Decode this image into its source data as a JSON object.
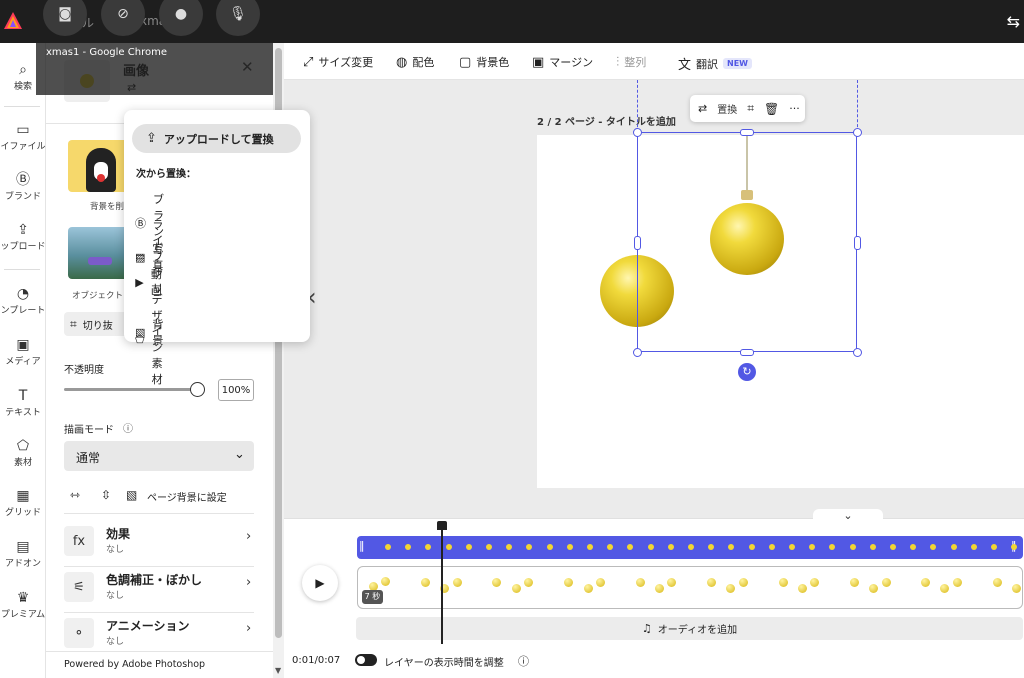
{
  "topbar": {
    "file_label": "ファイル",
    "doc_label": "xmas1",
    "chrome_label": "xmas1 - Google Chrome",
    "recorder": {
      "camera": "camera-icon",
      "no_cam": "camera-off-icon",
      "record": "record-icon",
      "mic": "microphone-icon"
    }
  },
  "leftnav": [
    {
      "icon": "search-icon",
      "glyph": "⌕",
      "label": "検索"
    },
    {
      "icon": "folder-icon",
      "glyph": "▭",
      "label": "イファイル"
    },
    {
      "icon": "brand-icon",
      "glyph": "Ⓑ",
      "label": "ブランド"
    },
    {
      "icon": "upload-icon",
      "glyph": "⇪",
      "label": "ップロード"
    },
    {
      "icon": "template-icon",
      "glyph": "◔",
      "label": "ンプレート"
    },
    {
      "icon": "media-icon",
      "glyph": "▣",
      "label": "メディア"
    },
    {
      "icon": "text-icon",
      "glyph": "T",
      "label": "テキスト"
    },
    {
      "icon": "elements-icon",
      "glyph": "⬠",
      "label": "素材"
    },
    {
      "icon": "grid-icon",
      "glyph": "▦",
      "label": "グリッド"
    },
    {
      "icon": "addon-icon",
      "glyph": "▤",
      "label": "アドオン"
    },
    {
      "icon": "premium-icon",
      "glyph": "♛",
      "label": "プレミアム"
    }
  ],
  "panel": {
    "header_title": "画像",
    "thumb1_caption": "背景を削",
    "thumb2_caption": "オブジェクト",
    "crop_label": "切り抜",
    "opacity_label": "不透明度",
    "opacity_value": "100%",
    "opacity_fraction": 1.0,
    "blend_label": "描画モード",
    "blend_value": "通常",
    "set_bg_label": "ページ背景に設定",
    "effects": [
      {
        "icon": "fx-icon",
        "glyph": "fx",
        "title": "効果",
        "sub": "なし"
      },
      {
        "icon": "adjust-icon",
        "glyph": "⚟",
        "title": "色調補正・ぼかし",
        "sub": "なし"
      },
      {
        "icon": "animation-icon",
        "glyph": "⚬",
        "title": "アニメーション",
        "sub": "なし"
      }
    ],
    "footer": "Powered by Adobe Photoshop"
  },
  "replace_menu": {
    "upload_label": "アップロードして置換",
    "section_label": "次から置換：",
    "items": [
      {
        "icon": "brand-icon",
        "glyph": "Ⓑ",
        "label": "ブランド"
      },
      {
        "icon": "folder-icon",
        "glyph": "▭",
        "label": "ライブラリ"
      },
      {
        "icon": "photo-icon",
        "glyph": "▨",
        "label": "写真"
      },
      {
        "icon": "video-icon",
        "glyph": "▶",
        "label": "動画"
      },
      {
        "icon": "design-assets-icon",
        "glyph": "⬠",
        "label": "デザイン素材"
      },
      {
        "icon": "background-icon",
        "glyph": "▧",
        "label": "背景"
      }
    ]
  },
  "toolbar": {
    "items": [
      {
        "icon": "resize-icon",
        "glyph": "⤢",
        "label": "サイズ変更"
      },
      {
        "icon": "palette-icon",
        "glyph": "◍",
        "label": "配色"
      },
      {
        "icon": "bg-color-icon",
        "glyph": "▢",
        "label": "背景色"
      },
      {
        "icon": "margin-icon",
        "glyph": "▣",
        "label": "マージン"
      },
      {
        "icon": "align-icon",
        "glyph": "⫶",
        "label": "整列"
      },
      {
        "icon": "translate-icon",
        "glyph": "文",
        "label": "翻訳"
      }
    ],
    "new_badge": "NEW"
  },
  "canvas": {
    "page_label": "2 / 2 ページ - タイトルを追加",
    "context": {
      "replace_label": "置換",
      "crop": "crop-icon",
      "delete": "trash-icon",
      "more": "···"
    }
  },
  "timeline": {
    "duration_badge": "7 秒",
    "add_audio": "オーディオを追加",
    "time": "0:01/0:07",
    "toggle_label": "レイヤーの表示時間を調整"
  },
  "colors": {
    "accent": "#5258e4",
    "ornament": "#e8cf2a",
    "dark": "#1e1e1e"
  }
}
